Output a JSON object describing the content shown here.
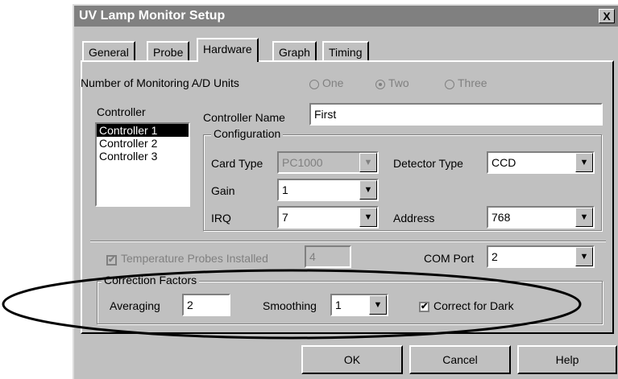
{
  "window": {
    "title": "UV Lamp Monitor Setup",
    "close_glyph": "X"
  },
  "tabs": [
    {
      "label": "General"
    },
    {
      "label": "Probe"
    },
    {
      "label": "Hardware"
    },
    {
      "label": "Graph"
    },
    {
      "label": "Timing"
    }
  ],
  "active_tab": "Hardware",
  "monitoring": {
    "label": "Number of Monitoring A/D Units",
    "options": [
      "One",
      "Two",
      "Three"
    ],
    "selected": "Two"
  },
  "controller": {
    "label": "Controller",
    "items": [
      "Controller 1",
      "Controller 2",
      "Controller 3"
    ],
    "selected": "Controller 1",
    "name_label": "Controller Name",
    "name_value": "First"
  },
  "configuration": {
    "label": "Configuration",
    "card_type_label": "Card Type",
    "card_type_value": "PC1000",
    "detector_type_label": "Detector Type",
    "detector_type_value": "CCD",
    "gain_label": "Gain",
    "gain_value": "1",
    "irq_label": "IRQ",
    "irq_value": "7",
    "address_label": "Address",
    "address_value": "768"
  },
  "probes": {
    "label": "Temperature Probes Installed",
    "checked": true,
    "count": "4",
    "com_label": "COM Port",
    "com_value": "2"
  },
  "correction": {
    "label": "Correction Factors",
    "averaging_label": "Averaging",
    "averaging_value": "2",
    "smoothing_label": "Smoothing",
    "smoothing_value": "1",
    "dark_label": "Correct for Dark",
    "dark_checked": true
  },
  "buttons": {
    "ok": "OK",
    "cancel": "Cancel",
    "help": "Help"
  },
  "icons": {
    "dropdown": "▼",
    "check": "✔"
  }
}
